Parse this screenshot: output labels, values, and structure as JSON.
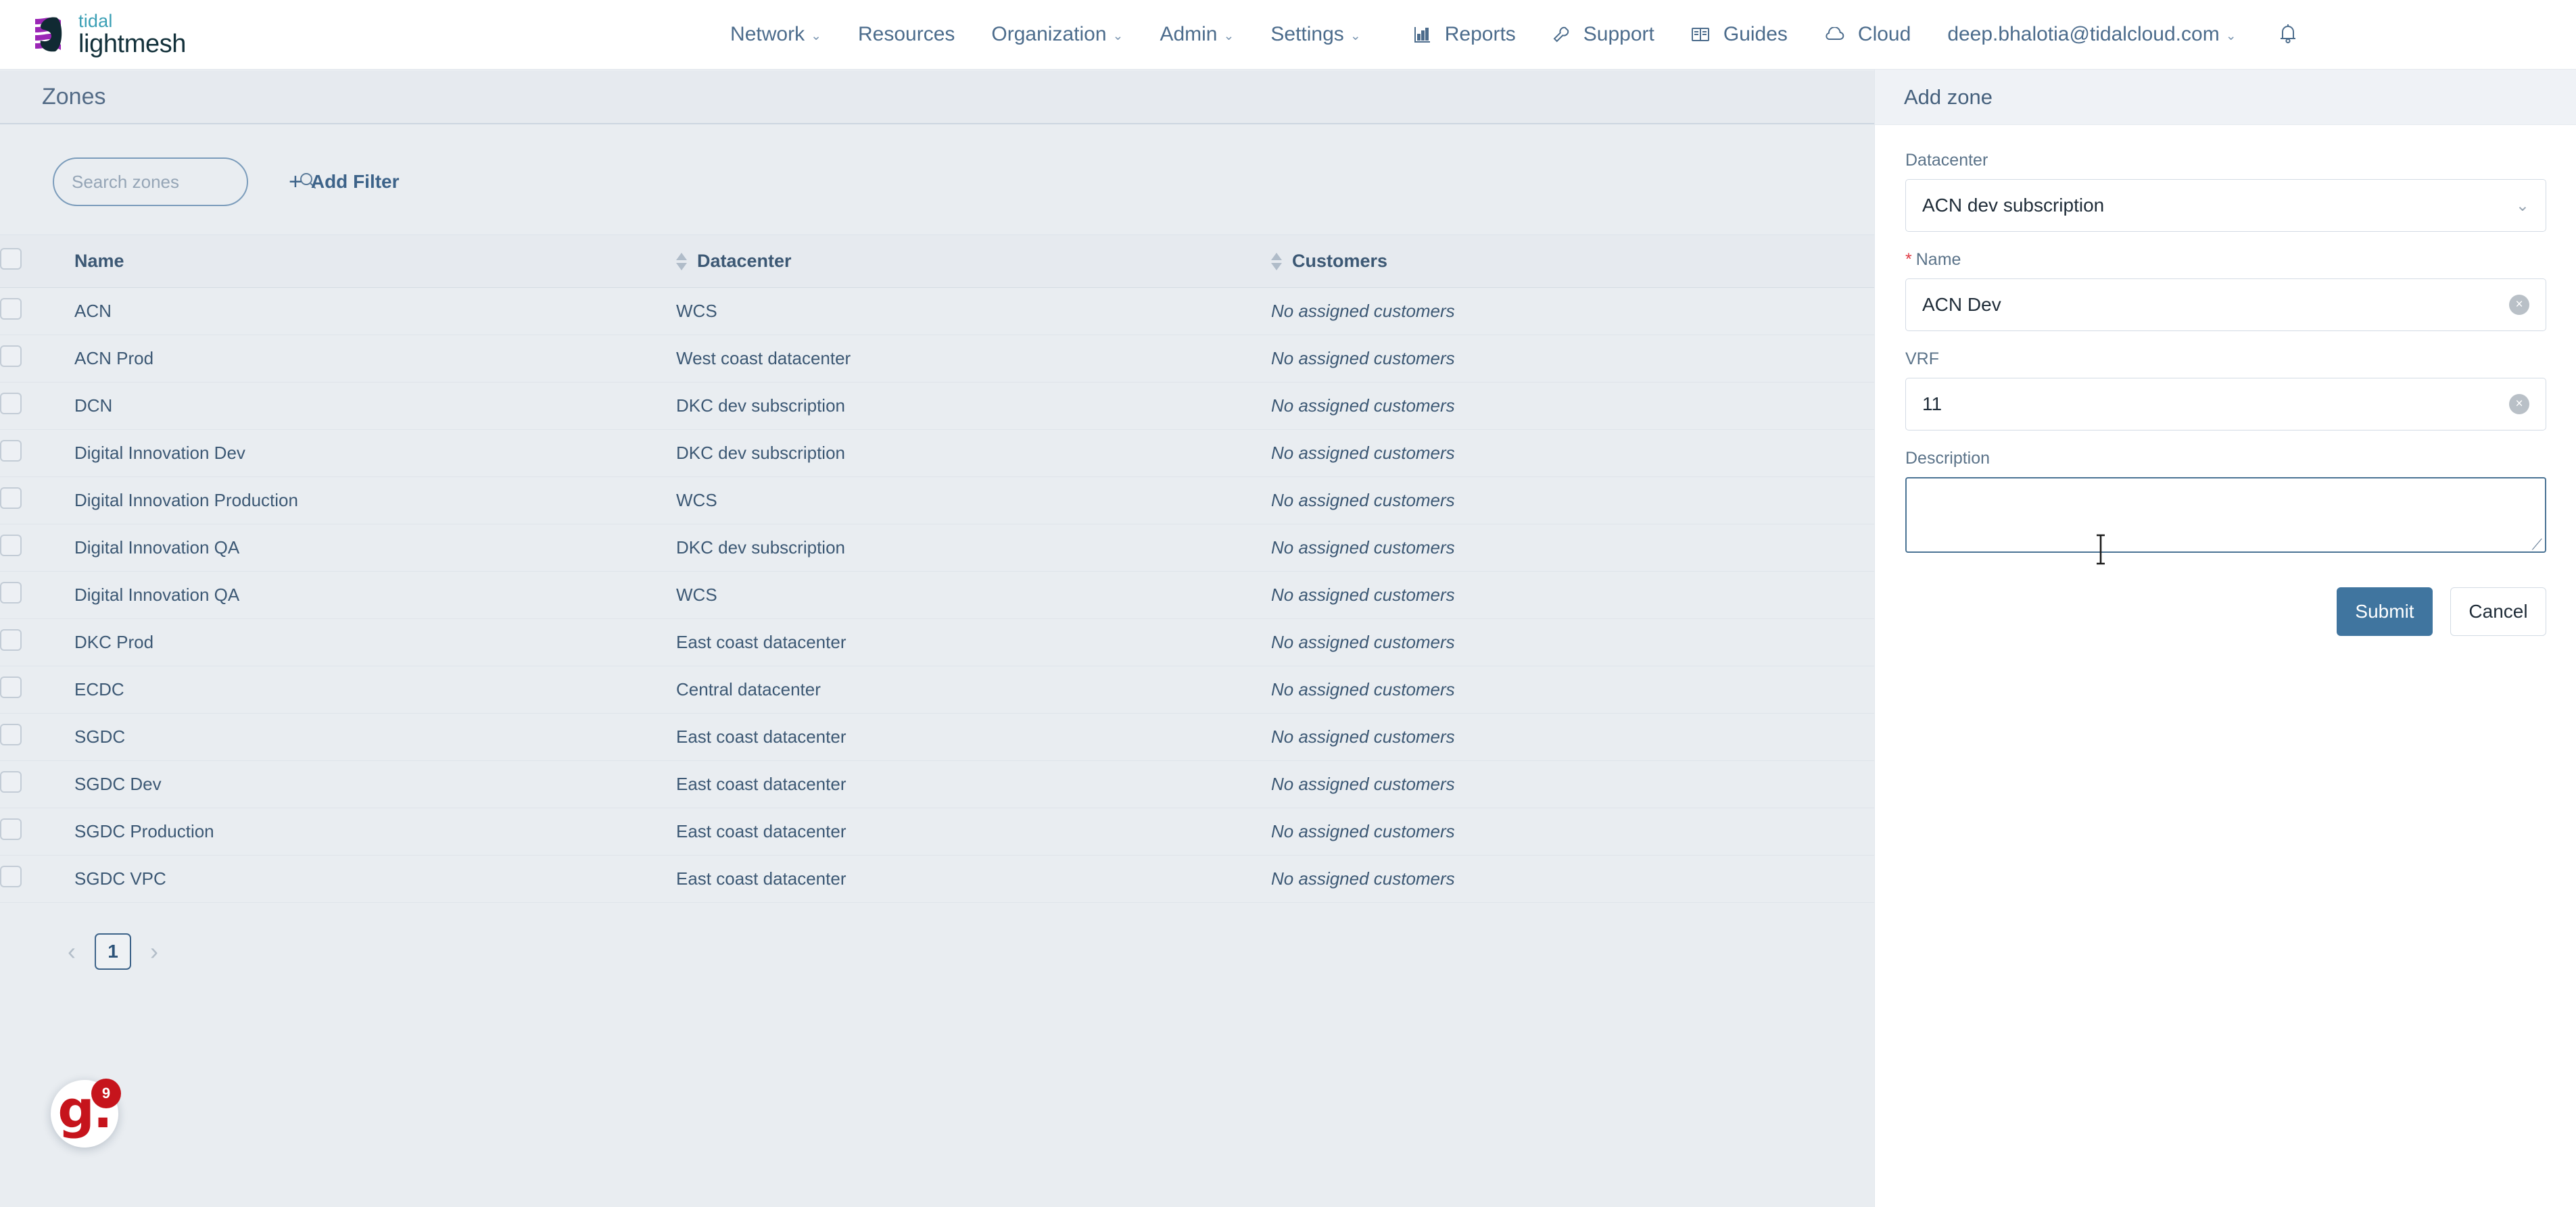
{
  "brand": {
    "name_top": "tidal",
    "name_bottom": "lightmesh",
    "logo_purple": "#9b26b6",
    "logo_dark": "#102a33",
    "tidal_color": "#3a9fb5"
  },
  "topnav": {
    "items": [
      {
        "label": "Network",
        "has_caret": true,
        "icon": ""
      },
      {
        "label": "Resources",
        "has_caret": false,
        "icon": ""
      },
      {
        "label": "Organization",
        "has_caret": true,
        "icon": ""
      },
      {
        "label": "Admin",
        "has_caret": true,
        "icon": ""
      },
      {
        "label": "Settings",
        "has_caret": true,
        "icon": ""
      }
    ],
    "right_items": [
      {
        "label": "Reports",
        "icon": "bar-chart-icon"
      },
      {
        "label": "Support",
        "icon": "wrench-icon"
      },
      {
        "label": "Guides",
        "icon": "book-icon"
      },
      {
        "label": "Cloud",
        "icon": "cloud-icon"
      }
    ],
    "user_email": "deep.bhalotia@tidalcloud.com",
    "user_caret": "⌄",
    "bell_icon": "bell-icon"
  },
  "page": {
    "tab_label": "Zones"
  },
  "toolbar": {
    "search_placeholder": "Search zones",
    "search_value": "",
    "search_icon": "search-icon",
    "add_filter_label": "Add Filter",
    "add_filter_plus": "+"
  },
  "table": {
    "columns": [
      {
        "key": "name",
        "label": "Name",
        "sortable": true
      },
      {
        "key": "datacenter",
        "label": "Datacenter",
        "sortable": true
      },
      {
        "key": "customers",
        "label": "Customers",
        "sortable": true
      }
    ],
    "rows": [
      {
        "name": "ACN",
        "datacenter": "WCS",
        "customers": "No assigned customers"
      },
      {
        "name": "ACN Prod",
        "datacenter": "West coast datacenter",
        "customers": "No assigned customers"
      },
      {
        "name": "DCN",
        "datacenter": "DKC dev subscription",
        "customers": "No assigned customers"
      },
      {
        "name": "Digital Innovation Dev",
        "datacenter": "DKC dev subscription",
        "customers": "No assigned customers"
      },
      {
        "name": "Digital Innovation Production",
        "datacenter": "WCS",
        "customers": "No assigned customers"
      },
      {
        "name": "Digital Innovation QA",
        "datacenter": "DKC dev subscription",
        "customers": "No assigned customers"
      },
      {
        "name": "Digital Innovation QA",
        "datacenter": "WCS",
        "customers": "No assigned customers"
      },
      {
        "name": "DKC Prod",
        "datacenter": "East coast datacenter",
        "customers": "No assigned customers"
      },
      {
        "name": "ECDC",
        "datacenter": "Central datacenter",
        "customers": "No assigned customers"
      },
      {
        "name": "SGDC",
        "datacenter": "East coast datacenter",
        "customers": "No assigned customers"
      },
      {
        "name": "SGDC Dev",
        "datacenter": "East coast datacenter",
        "customers": "No assigned customers"
      },
      {
        "name": "SGDC Production",
        "datacenter": "East coast datacenter",
        "customers": "No assigned customers"
      },
      {
        "name": "SGDC VPC",
        "datacenter": "East coast datacenter",
        "customers": "No assigned customers"
      }
    ]
  },
  "pagination": {
    "prev": "‹",
    "next": "›",
    "current_page": "1"
  },
  "help_widget": {
    "glyph": "g.",
    "badge_count": "9"
  },
  "drawer": {
    "title": "Add zone",
    "fields": {
      "datacenter": {
        "label": "Datacenter",
        "value": "ACN dev subscription",
        "chevron": "⌄"
      },
      "name": {
        "label": "Name",
        "required_marker": "*",
        "value": "ACN Dev",
        "clear": "×"
      },
      "vrf": {
        "label": "VRF",
        "value": "11",
        "clear": "×"
      },
      "description": {
        "label": "Description",
        "value": "",
        "placeholder": ""
      }
    },
    "submit_label": "Submit",
    "cancel_label": "Cancel",
    "submit_color": "#40759f"
  }
}
